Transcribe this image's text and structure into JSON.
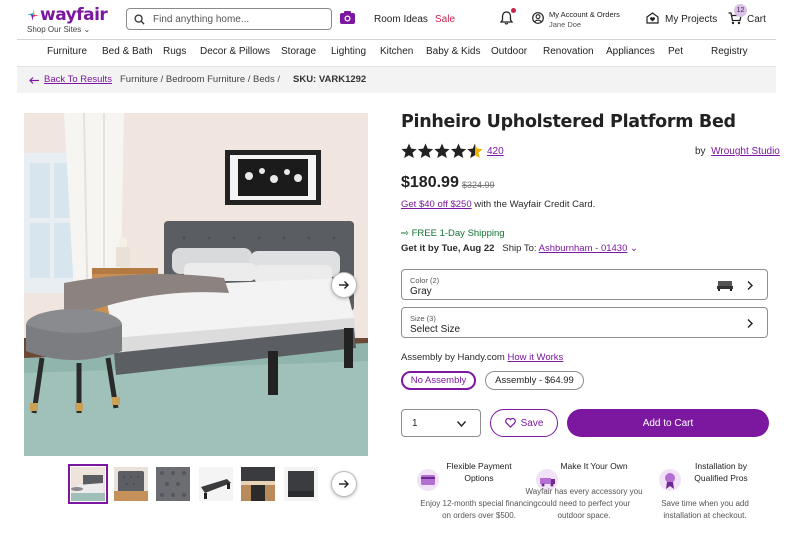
{
  "header": {
    "logo": "wayfair",
    "shop_sites": "Shop Our Sites",
    "search_placeholder": "Find anything home...",
    "room_ideas": "Room Ideas",
    "sale": "Sale",
    "account_line1": "My Account & Orders",
    "account_name": "Jane Doe",
    "projects": "My Projects",
    "cart": "Cart",
    "cart_count": "12"
  },
  "nav": [
    "Furniture",
    "Bed & Bath",
    "Rugs",
    "Decor & Pillows",
    "Storage",
    "Lighting",
    "Kitchen",
    "Baby & Kids",
    "Outdoor",
    "Renovation",
    "Appliances",
    "Pet",
    "Registry"
  ],
  "breadcrumb": {
    "back": "Back To Results",
    "path": "Furniture / Bedroom Furniture / Beds /",
    "sku": "SKU: VARK1292"
  },
  "product": {
    "title": "Pinheiro Upholstered Platform Bed",
    "rating": 4.5,
    "review_count": "420",
    "by_label": "by",
    "brand": "Wrought Studio",
    "price": "$180.99",
    "old_price": "$324.99",
    "credit_link": "Get $40 off $250",
    "credit_text": "with the Wayfair Credit Card.",
    "shipping": "FREE 1-Day Shipping",
    "get_it": "Get it by Tue, Aug 22",
    "ship_to_label": "Ship To:",
    "ship_to": "Ashburnham - 01430",
    "color_label": "Color (2)",
    "color_value": "Gray",
    "size_label": "Size (3)",
    "size_value": "Select Size",
    "assembly_text": "Assembly by Handy.com",
    "assembly_link": "How it Works",
    "assembly_opt1": "No Assembly",
    "assembly_opt2": "Assembly - $64.99",
    "quantity": "1",
    "save": "Save",
    "add_to_cart": "Add to Cart"
  },
  "features": [
    {
      "title": "Flexible Payment Options",
      "body": "Enjoy 12-month special financing on orders over $500."
    },
    {
      "title": "Make It Your Own",
      "body": "Wayfair has every accessory you could need to perfect your outdoor space."
    },
    {
      "title": "Installation by Qualified Pros",
      "body": "Save time when you add installation at checkout."
    }
  ],
  "colors": {
    "brand": "#7b189f",
    "sale": "#c7254e",
    "shipping": "#137333",
    "star": "#222222"
  }
}
